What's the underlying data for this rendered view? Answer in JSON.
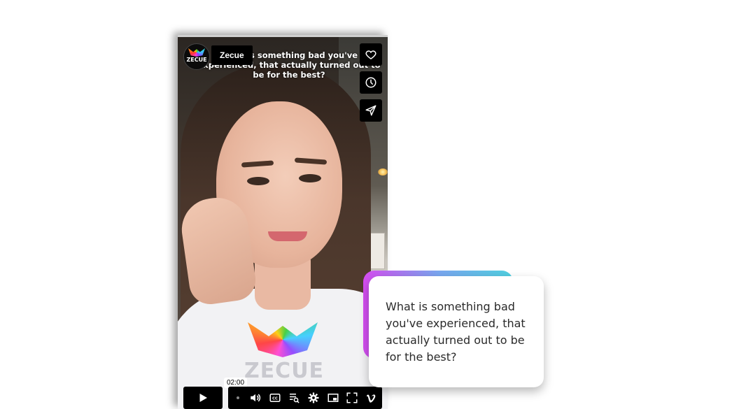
{
  "video": {
    "caption": "What is something bad you've experienced, that actually turned out to be for the best?",
    "shirt_brand": "ZECUE"
  },
  "channel": {
    "name": "Zecue",
    "avatar_text": "ZECUE"
  },
  "side_actions": [
    {
      "icon": "heart-icon"
    },
    {
      "icon": "clock-icon"
    },
    {
      "icon": "send-icon"
    }
  ],
  "player": {
    "play_icon": "play-icon",
    "time_tooltip": "02:00",
    "controls": [
      "volume-icon",
      "closed-captions-icon",
      "transcript-icon",
      "settings-icon",
      "picture-in-picture-icon",
      "fullscreen-icon",
      "vimeo-logo-icon"
    ]
  },
  "prompt_card": {
    "text": "What is something bad you've experienced, that actually turned out to be for the best?",
    "accent_colors": [
      "#d54cf0",
      "#7aa6f0",
      "#4fd0e0"
    ]
  }
}
